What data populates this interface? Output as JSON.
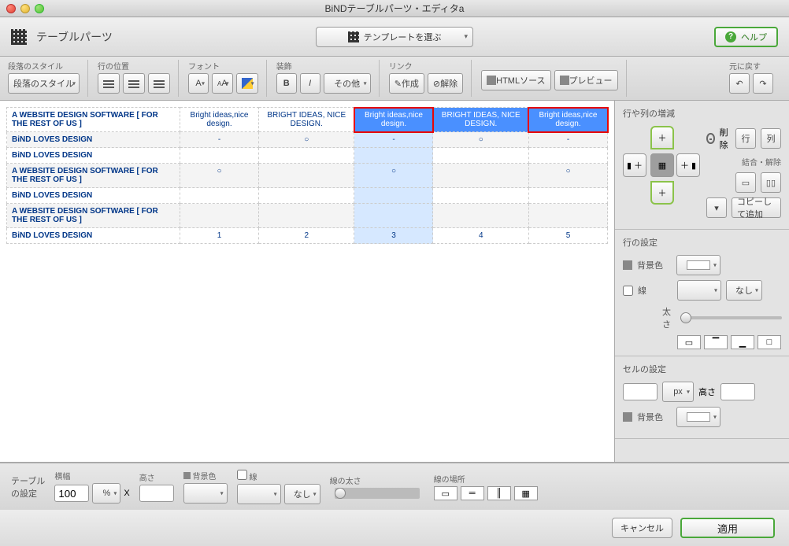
{
  "window": {
    "title": "BiNDテーブルパーツ・エディタa"
  },
  "header": {
    "parts_label": "テーブルパーツ",
    "template_label": "テンプレートを選ぶ",
    "help_label": "ヘルプ"
  },
  "toolbar": {
    "para_style_label": "段落のスタイル",
    "para_style_value": "段落のスタイル",
    "row_pos_label": "行の位置",
    "font_label": "フォント",
    "decoration_label": "装飾",
    "font_A": "A",
    "font_AA": "AA",
    "bold": "B",
    "italic": "I",
    "other": "その他",
    "link_label": "リンク",
    "link_create": "作成",
    "link_remove": "解除",
    "html_src": "HTMLソース",
    "preview": "プレビュー",
    "undo_label": "元に戻す"
  },
  "table": {
    "rows": [
      {
        "c0": "A WEBSITE DESIGN SOFTWARE [ FOR THE REST OF US ]",
        "c1": "Bright ideas,nice design.",
        "c2": "BRIGHT IDEAS, NICE DESIGN.",
        "c3": "Bright ideas,nice design.",
        "c4": "BRIGHT IDEAS, NICE DESIGN.",
        "c5": "Bright ideas,nice design."
      },
      {
        "c0": "BiND LOVES DESIGN",
        "c1": "-",
        "c2": "○",
        "c3": "-",
        "c4": "○",
        "c5": "-"
      },
      {
        "c0": "BiND LOVES DESIGN",
        "c1": "",
        "c2": "",
        "c3": "",
        "c4": "",
        "c5": ""
      },
      {
        "c0": "A WEBSITE DESIGN SOFTWARE [ FOR THE REST OF US ]",
        "c1": "○",
        "c2": "",
        "c3": "○",
        "c4": "",
        "c5": "○"
      },
      {
        "c0": "BiND LOVES DESIGN",
        "c1": "",
        "c2": "",
        "c3": "",
        "c4": "",
        "c5": ""
      },
      {
        "c0": "A WEBSITE DESIGN SOFTWARE [ FOR THE REST OF US ]",
        "c1": "",
        "c2": "",
        "c3": "",
        "c4": "",
        "c5": ""
      },
      {
        "c0": "BiND LOVES DESIGN",
        "c1": "1",
        "c2": "2",
        "c3": "3",
        "c4": "4",
        "c5": "5"
      }
    ]
  },
  "side": {
    "rowcol_title": "行や列の増減",
    "delete": "削除",
    "row_icon": "行",
    "col_icon": "列",
    "merge_split": "結合・解除",
    "copy_add": "コピーして追加",
    "row_settings": "行の設定",
    "bgcolor": "背景色",
    "line": "線",
    "none": "なし",
    "thickness": "太さ",
    "cell_settings": "セルの設定",
    "unit_px": "px",
    "height": "高さ"
  },
  "bottom": {
    "table_settings": "テーブル\nの設定",
    "width_label": "横幅",
    "width_value": "100",
    "unit_pct": "%",
    "times": "X",
    "height_label": "高さ",
    "bgcolor": "背景色",
    "line": "線",
    "none": "なし",
    "thickness": "線の太さ",
    "line_loc": "線の場所"
  },
  "footer": {
    "cancel": "キャンセル",
    "apply": "適用"
  }
}
